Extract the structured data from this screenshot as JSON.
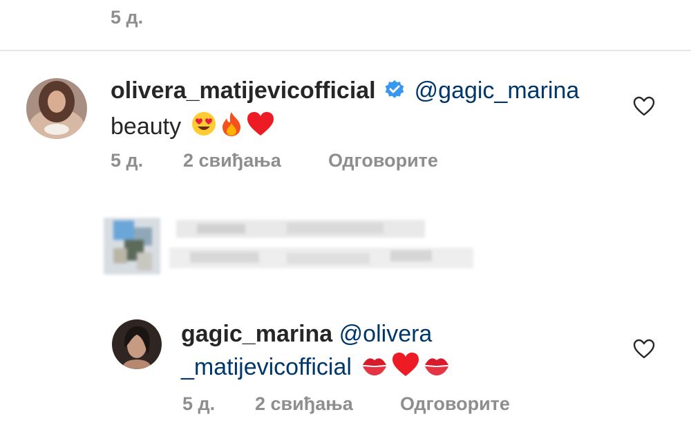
{
  "top": {
    "time": "5 д."
  },
  "comment1": {
    "username": "olivera_matijevicofficial",
    "mention": "@gagic_marina",
    "text": "beauty",
    "emojis": [
      "smiling-face-heart-eyes",
      "fire",
      "red-heart"
    ],
    "time": "5 д.",
    "likes": "2 свиђања",
    "reply": "Одговорите"
  },
  "reply1": {
    "username": "gagic_marina",
    "mention_part1": "@olivera",
    "mention_part2": "_matijevicofficial",
    "emojis": [
      "kiss-mark",
      "red-heart",
      "kiss-mark"
    ],
    "time": "5 д.",
    "likes": "2 свиђања",
    "reply": "Одговорите"
  },
  "colors": {
    "meta": "#8e8e8e",
    "mention": "#00376b",
    "verified": "#3897f0",
    "heart": "#ed1c24"
  }
}
